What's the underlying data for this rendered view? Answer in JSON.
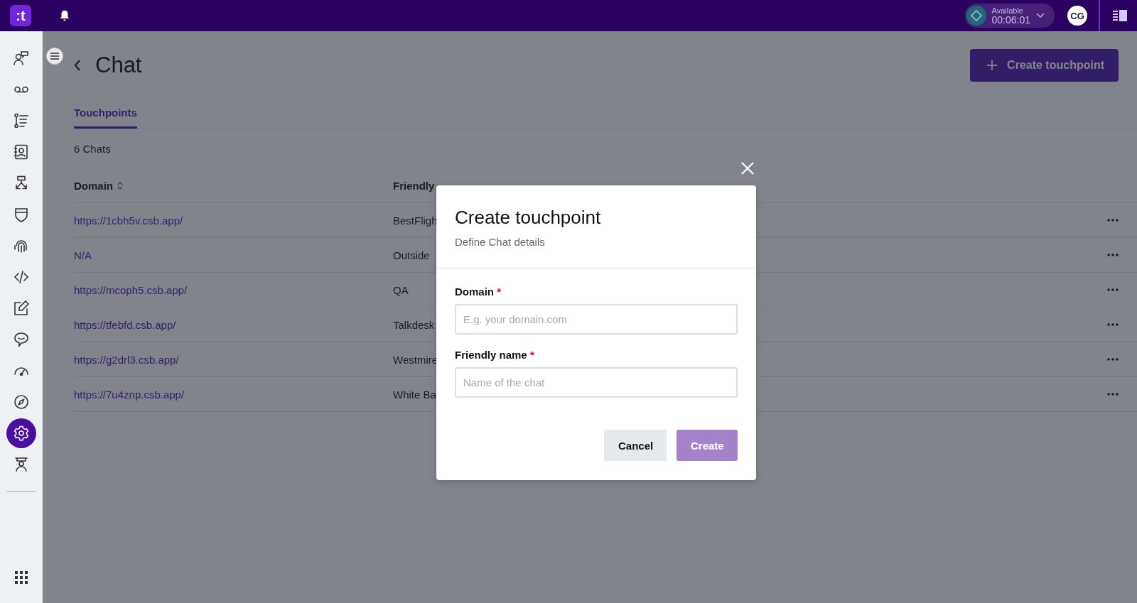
{
  "topbar": {
    "logo_text": ":t",
    "status": {
      "label": "Available",
      "timer": "00:06:01"
    },
    "avatar": "CG"
  },
  "sidebar": {
    "items": [
      {
        "selected": false
      },
      {
        "selected": false
      },
      {
        "selected": false
      },
      {
        "selected": false
      },
      {
        "selected": false
      },
      {
        "selected": false
      },
      {
        "selected": false
      },
      {
        "selected": false
      },
      {
        "selected": false
      },
      {
        "selected": false
      },
      {
        "selected": false
      },
      {
        "selected": false
      },
      {
        "selected": true
      },
      {
        "selected": false
      }
    ]
  },
  "page": {
    "title": "Chat",
    "create_button": "Create touchpoint"
  },
  "tabs": [
    {
      "label": "Touchpoints",
      "selected": true
    }
  ],
  "count": "6 Chats",
  "table": {
    "columns": [
      "Domain",
      "Friendly"
    ],
    "rows": [
      {
        "domain": "https://1cbh5v.csb.app/",
        "name": "BestFligh"
      },
      {
        "domain": "N/A",
        "name": "Outside"
      },
      {
        "domain": "https://mcoph5.csb.app/",
        "name": "QA"
      },
      {
        "domain": "https://tfebfd.csb.app/",
        "name": "Talkdesk"
      },
      {
        "domain": "https://g2drl3.csb.app/",
        "name": "Westmire"
      },
      {
        "domain": "https://7u4znp.csb.app/",
        "name": "White Ba"
      }
    ]
  },
  "modal": {
    "title": "Create touchpoint",
    "subtitle": "Define Chat details",
    "fields": [
      {
        "label": "Domain",
        "required_mark": "*",
        "placeholder": "E.g. your domain.com"
      },
      {
        "label": "Friendly name",
        "required_mark": "*",
        "placeholder": "Name of the chat"
      }
    ],
    "buttons": [
      {
        "label": "Cancel",
        "kind": "secondary",
        "disabled": false
      },
      {
        "label": "Create",
        "kind": "primary",
        "disabled": true
      }
    ]
  }
}
